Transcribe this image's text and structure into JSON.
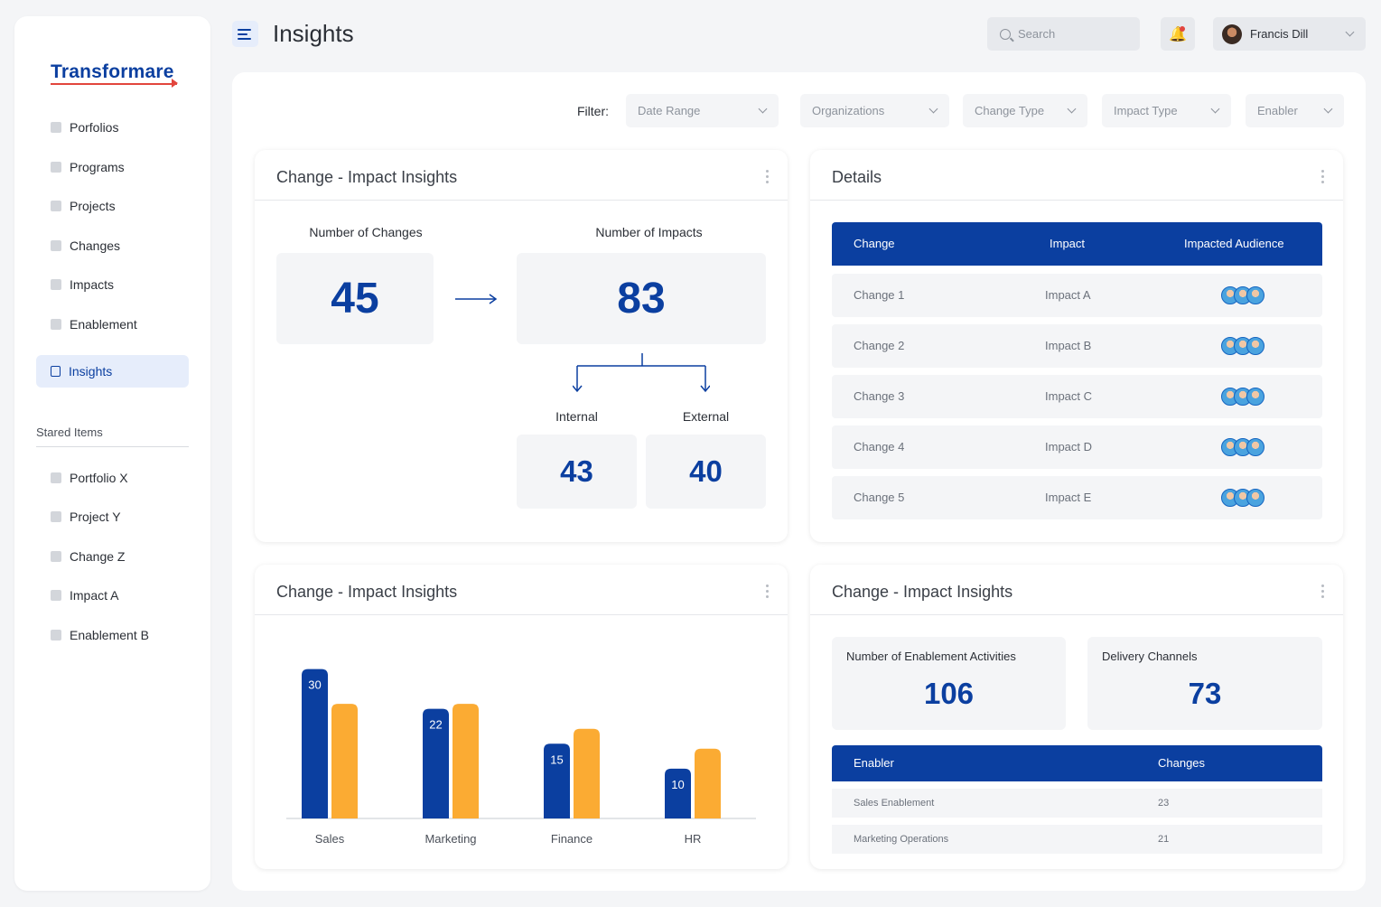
{
  "app": {
    "logo": "Transformare",
    "page_title": "Insights"
  },
  "header": {
    "search_placeholder": "Search",
    "user_name": "Francis Dill"
  },
  "sidebar": {
    "nav": [
      {
        "label": "Porfolios"
      },
      {
        "label": "Programs"
      },
      {
        "label": "Projects"
      },
      {
        "label": "Changes"
      },
      {
        "label": "Impacts"
      },
      {
        "label": "Enablement"
      },
      {
        "label": "Insights",
        "active": true
      }
    ],
    "stared_title": "Stared Items",
    "stared": [
      {
        "label": "Portfolio  X"
      },
      {
        "label": "Project  Y"
      },
      {
        "label": "Change  Z"
      },
      {
        "label": "Impact  A"
      },
      {
        "label": "Enablement  B"
      }
    ]
  },
  "filters": {
    "label": "Filter:",
    "items": [
      "Date Range",
      "Organizations",
      "Change Type",
      "Impact Type",
      "Enabler"
    ]
  },
  "card_impact": {
    "title": "Change - Impact Insights",
    "changes_label": "Number of Changes",
    "changes_value": "45",
    "impacts_label": "Number of Impacts",
    "impacts_value": "83",
    "internal_label": "Internal",
    "internal_value": "43",
    "external_label": "External",
    "external_value": "40"
  },
  "card_details": {
    "title": "Details",
    "columns": [
      "Change",
      "Impact",
      "Impacted Audience"
    ],
    "rows": [
      {
        "change": "Change 1",
        "impact": "Impact A"
      },
      {
        "change": "Change 2",
        "impact": "Impact B"
      },
      {
        "change": "Change 3",
        "impact": "Impact C"
      },
      {
        "change": "Change 4",
        "impact": "Impact D"
      },
      {
        "change": "Change 5",
        "impact": "Impact E"
      }
    ]
  },
  "card_chart": {
    "title": "Change - Impact Insights"
  },
  "chart_data": {
    "type": "bar",
    "categories": [
      "Sales",
      "Marketing",
      "Finance",
      "HR"
    ],
    "series": [
      {
        "values": [
          30,
          22,
          15,
          10
        ],
        "color": "#0b3fa0",
        "labeled": true
      },
      {
        "values": [
          23,
          23,
          18,
          14
        ],
        "color": "#fbab33",
        "labeled": false
      }
    ],
    "ylim": [
      0,
      35
    ],
    "legend": "none",
    "grid": false
  },
  "card_enable": {
    "title": "Change - Impact Insights",
    "activities_label": "Number of Enablement Activities",
    "activities_value": "106",
    "channels_label": "Delivery Channels",
    "channels_value": "73",
    "columns": [
      "Enabler",
      "Changes"
    ],
    "rows": [
      {
        "enabler": "Sales Enablement",
        "changes": "23"
      },
      {
        "enabler": "Marketing Operations",
        "changes": "21"
      }
    ]
  },
  "colors": {
    "primary": "#0b3fa0",
    "accent": "#fbab33",
    "brand_red": "#e2453d"
  }
}
